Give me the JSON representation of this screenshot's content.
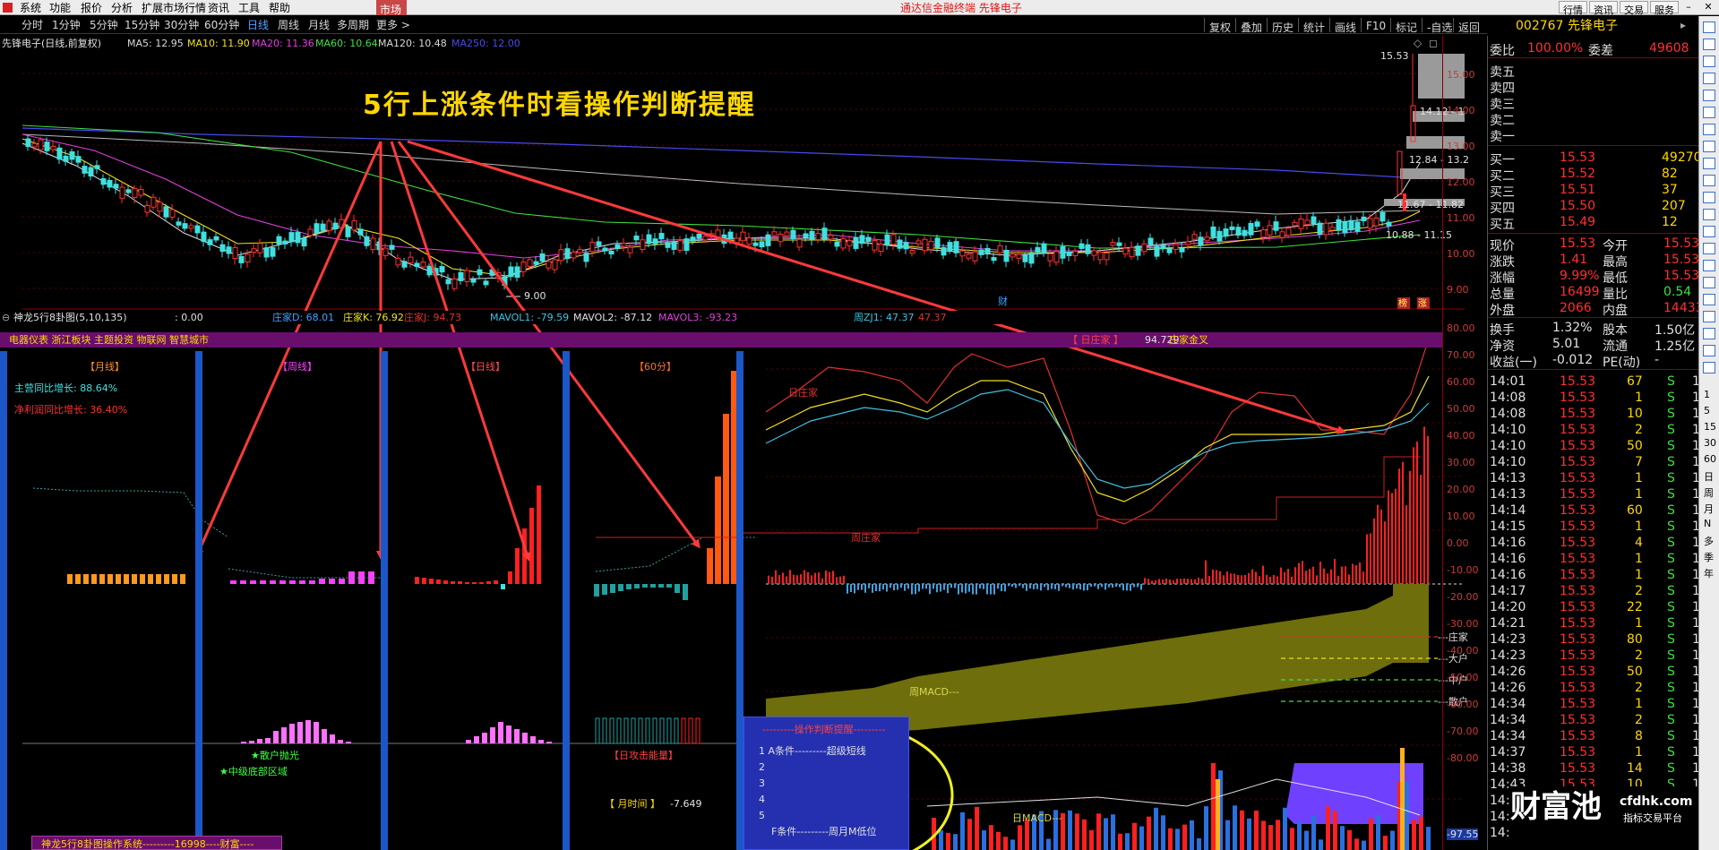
{
  "menu": {
    "items": [
      "系统",
      "功能",
      "报价",
      "分析",
      "扩展市场行情",
      "资讯",
      "工具",
      "帮助"
    ],
    "market": "市场",
    "center_title": "通达信金融终端  先锋电子",
    "right_buttons": [
      "行情",
      "资讯",
      "交易",
      "服务"
    ]
  },
  "toolbar": {
    "periods": [
      "分时",
      "1分钟",
      "5分钟",
      "15分钟",
      "30分钟",
      "60分钟",
      "日线",
      "周线",
      "月线",
      "多周期",
      "更多 >"
    ],
    "active_period": "日线",
    "right_tools": [
      "复权",
      "叠加",
      "历史",
      "统计",
      "画线",
      "F10",
      "标记",
      "-自选",
      "返回"
    ]
  },
  "stock": {
    "code": "002767",
    "name": "先锋电子"
  },
  "ma_line": {
    "title": "先锋电子(日线,前复权)",
    "items": [
      {
        "text": "MA5: 12.95",
        "color": "#d8d8d8"
      },
      {
        "text": "MA10: 11.90",
        "color": "#f0e020"
      },
      {
        "text": "MA20: 11.36",
        "color": "#e040e0"
      },
      {
        "text": "MA60: 10.64",
        "color": "#40e040"
      },
      {
        "text": "MA120: 10.48",
        "color": "#d8d8d8"
      },
      {
        "text": "MA250: 12.00",
        "color": "#4a4af0"
      }
    ]
  },
  "annotation": "5行上涨条件时看操作判断提醒",
  "price_labels": [
    {
      "text": "15.53"
    },
    {
      "text": "14.12 - 1"
    },
    {
      "text": "12.84 - 13.2"
    },
    {
      "text": "11.67 - 11.82"
    },
    {
      "text": "10.88 - 11.15"
    },
    {
      "text": "9.00"
    }
  ],
  "price_axis": [
    "15.00",
    "14.00",
    "13.00",
    "12.00",
    "11.00",
    "10.00",
    "9.00"
  ],
  "indicator_line": {
    "title": "神龙5行8卦图(5,10,135)",
    "value": ": 0.00",
    "items": [
      {
        "text": "庄家D: 68.01",
        "color": "#40a0ff"
      },
      {
        "text": "庄家K: 76.92",
        "color": "#f0e020"
      },
      {
        "text": "庄家J: 94.73",
        "color": "#e03030"
      },
      {
        "text": "MAVOL1: -79.59",
        "color": "#40c0e0"
      },
      {
        "text": "MAVOL2: -87.12",
        "color": "#e0e0e0"
      },
      {
        "text": "MAVOL3: -93.23",
        "color": "#e040e0"
      },
      {
        "text": "周ZJ1: 47.37",
        "color": "#40c0e0"
      },
      {
        "text": "47.37",
        "color": "#e03030"
      }
    ]
  },
  "panel_header": {
    "sectors": "电器仪表  浙江板块  主题投资  物联网  智慧城市",
    "right_label": "【 日庄家 】",
    "right_value": "94.729",
    "right_text": "庄家金叉"
  },
  "sections": {
    "monthly": "【月线】",
    "weekly": "【周线】",
    "daily": "【日线】",
    "min60": "【60分】",
    "main_growth": "主营同比增长: 88.64%",
    "profit_growth": "净利润同比增长: 36.40%",
    "retail_sell": "★散户抛光",
    "mid_bottom": "★中级底部区域",
    "daily_attack": "【日攻击能量】",
    "month_time_label": "【 月时间 】",
    "month_time_value": "-7.649",
    "bottom_system": "神龙5行8卦图操作系统---------16998----财富----"
  },
  "chart_labels": {
    "day_zhuang": "日庄家",
    "week_zhuang": "周庄家",
    "zhou_macd": "周MACD---",
    "ri_macd": "日MACD---",
    "legend": [
      "---庄家",
      "---大户",
      "---中户",
      "---散户"
    ],
    "cai": "财",
    "bang": "榜",
    "zhang": "涨"
  },
  "indicator_axis": [
    "80.00",
    "70.00",
    "60.00",
    "50.00",
    "40.00",
    "30.00",
    "20.00",
    "10.00",
    "0.00",
    "-10.00",
    "-20.00",
    "-30.00",
    "-40.00",
    "-50.00",
    "-60.00",
    "-70.00",
    "-80.00",
    "-97.55"
  ],
  "op_box": {
    "title": "---------操作判断提醒---------",
    "rows": [
      "1  A条件---------超级短线",
      "2",
      "3",
      "4",
      "5"
    ],
    "footer": "F条件---------周月M低位"
  },
  "quotes": {
    "ratio": {
      "l1": "委比",
      "v1": "100.00%",
      "l2": "委差",
      "v2": "49608"
    },
    "sells": [
      "卖五",
      "卖四",
      "卖三",
      "卖二",
      "卖一"
    ],
    "buys": [
      {
        "label": "买一",
        "price": "15.53",
        "vol": "49270"
      },
      {
        "label": "买二",
        "price": "15.52",
        "vol": "82"
      },
      {
        "label": "买三",
        "price": "15.51",
        "vol": "37"
      },
      {
        "label": "买四",
        "price": "15.50",
        "vol": "207"
      },
      {
        "label": "买五",
        "price": "15.49",
        "vol": "12"
      }
    ],
    "stats": [
      {
        "l1": "现价",
        "v1": "15.53",
        "l2": "今开",
        "v2": "15.53"
      },
      {
        "l1": "涨跌",
        "v1": "1.41",
        "l2": "最高",
        "v2": "15.53"
      },
      {
        "l1": "涨幅",
        "v1": "9.99%",
        "l2": "最低",
        "v2": "15.53"
      },
      {
        "l1": "总量",
        "v1": "16499",
        "l2": "量比",
        "v2": "0.54"
      },
      {
        "l1": "外盘",
        "v1": "2066",
        "l2": "内盘",
        "v2": "14433"
      }
    ],
    "fundamentals": [
      {
        "l1": "换手",
        "v1": "1.32%",
        "l2": "股本",
        "v2": "1.50亿"
      },
      {
        "l1": "净资",
        "v1": "5.01",
        "l2": "流通",
        "v2": "1.25亿"
      },
      {
        "l1": "收益(一)",
        "v1": "-0.012",
        "l2": "PE(动)",
        "v2": "-"
      }
    ],
    "ticks": [
      [
        "14:01",
        "15.53",
        "67"
      ],
      [
        "14:08",
        "15.53",
        "1"
      ],
      [
        "14:08",
        "15.53",
        "10"
      ],
      [
        "14:10",
        "15.53",
        "2"
      ],
      [
        "14:10",
        "15.53",
        "50"
      ],
      [
        "14:10",
        "15.53",
        "7"
      ],
      [
        "14:13",
        "15.53",
        "1"
      ],
      [
        "14:13",
        "15.53",
        "1"
      ],
      [
        "14:14",
        "15.53",
        "60"
      ],
      [
        "14:15",
        "15.53",
        "1"
      ],
      [
        "14:16",
        "15.53",
        "4"
      ],
      [
        "14:16",
        "15.53",
        "1"
      ],
      [
        "14:16",
        "15.53",
        "1"
      ],
      [
        "14:17",
        "15.53",
        "2"
      ],
      [
        "14:20",
        "15.53",
        "22"
      ],
      [
        "14:21",
        "15.53",
        "1"
      ],
      [
        "14:23",
        "15.53",
        "80"
      ],
      [
        "14:23",
        "15.53",
        "2"
      ],
      [
        "14:26",
        "15.53",
        "50"
      ],
      [
        "14:26",
        "15.53",
        "2"
      ],
      [
        "14:34",
        "15.53",
        "1"
      ],
      [
        "14:34",
        "15.53",
        "2"
      ],
      [
        "14:34",
        "15.53",
        "8"
      ],
      [
        "14:37",
        "15.53",
        "1"
      ],
      [
        "14:38",
        "15.53",
        "14"
      ],
      [
        "14:43",
        "15.53",
        "10"
      ],
      [
        "14:44",
        "15.53",
        "2"
      ],
      [
        "14:48",
        "15.53",
        "1"
      ],
      [
        "14:50",
        "15.53",
        "50"
      ]
    ],
    "tick_side": "S",
    "tick_tail": "1"
  },
  "sidebar": [
    "1",
    "5",
    "15",
    "30",
    "60",
    "日",
    "周",
    "月",
    "N",
    "多",
    "季",
    "年"
  ],
  "watermark": {
    "big": "财富池",
    "url": "cfdhk.com",
    "sub": "指标交易平台"
  },
  "colors": {
    "up": "#ff3030",
    "down": "#40e0e0",
    "ma5": "#d8d8d8",
    "ma10": "#f0e020",
    "ma20": "#e040e0",
    "ma60": "#40e040",
    "ma250": "#4a4af0",
    "arrow": "#ff3a3a",
    "gold": "#ffd700"
  }
}
